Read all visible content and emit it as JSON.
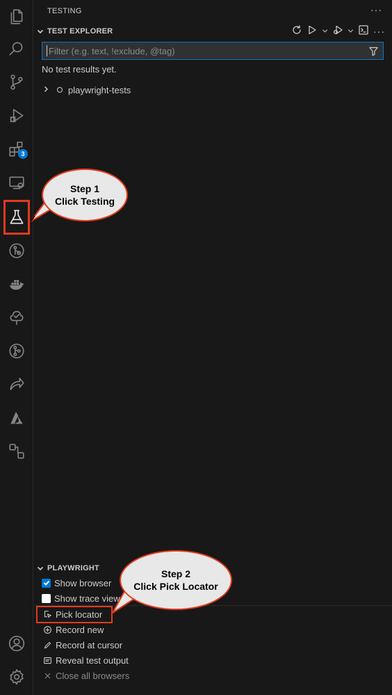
{
  "activity_bar": {
    "items": [
      {
        "name": "explorer"
      },
      {
        "name": "search"
      },
      {
        "name": "source-control"
      },
      {
        "name": "run-and-debug"
      },
      {
        "name": "extensions",
        "badge": "3"
      },
      {
        "name": "remote-explorer"
      },
      {
        "name": "testing"
      },
      {
        "name": "git-graph"
      },
      {
        "name": "docker"
      },
      {
        "name": "tree-check"
      },
      {
        "name": "git-branch"
      },
      {
        "name": "live-share"
      },
      {
        "name": "azure"
      },
      {
        "name": "connections"
      }
    ],
    "bottom": [
      {
        "name": "accounts"
      },
      {
        "name": "manage"
      }
    ]
  },
  "panel": {
    "title": "TESTING",
    "more": "···"
  },
  "test_explorer": {
    "header": "TEST EXPLORER",
    "filter_placeholder": "Filter (e.g. text, !exclude, @tag)",
    "no_results": "No test results yet.",
    "tree": [
      {
        "label": "playwright-tests"
      }
    ]
  },
  "playwright": {
    "header": "PLAYWRIGHT",
    "show_browser": "Show browser",
    "show_trace_viewer": "Show trace viewer",
    "pick_locator": "Pick locator",
    "record_new": "Record new",
    "record_at_cursor": "Record at cursor",
    "reveal_test_output": "Reveal test output",
    "close_all_browsers": "Close all browsers"
  },
  "callouts": {
    "step1": {
      "line1": "Step 1",
      "line2": "Click Testing"
    },
    "step2": {
      "line1": "Step 2",
      "line2": "Click Pick Locator"
    }
  },
  "colors": {
    "accent": "#0078d4",
    "highlight": "#e53a1e",
    "background": "#181818"
  }
}
